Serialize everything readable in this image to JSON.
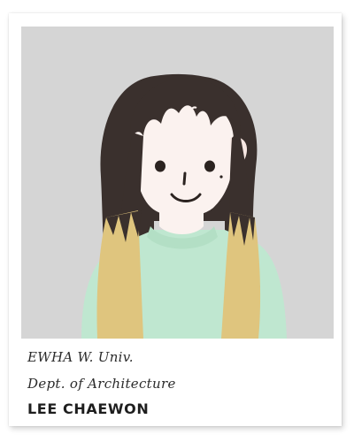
{
  "card": {
    "university": "EWHA W. Univ.",
    "department": "Dept. of Architecture",
    "name": "LEE CHAEWON"
  },
  "illustration": {
    "subject": "cartoon portrait",
    "colors": {
      "background": "#d5d5d5",
      "hair": "#3a302d",
      "hair_tips": "#dfc57e",
      "skin": "#fbf2ef",
      "sweater": "#bfe7d0",
      "earring": "#e8b64a"
    }
  }
}
